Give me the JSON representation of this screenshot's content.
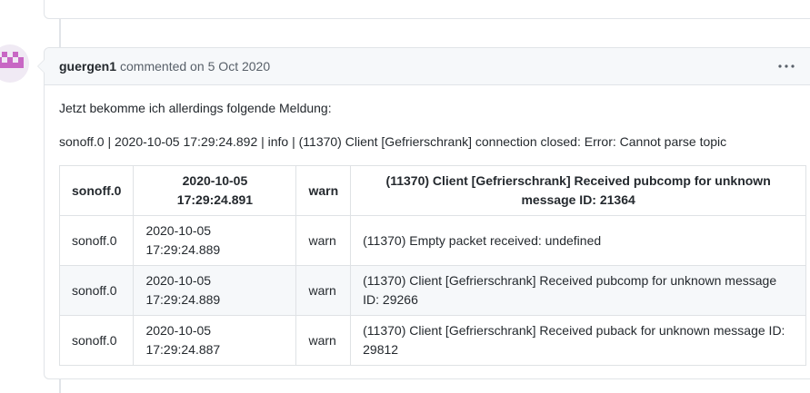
{
  "comment": {
    "author": "guergen1",
    "action_text": "commented on",
    "date": "5 Oct 2020",
    "paragraph1": "Jetzt bekomme ich allerdings folgende Meldung:",
    "paragraph2": "sonoff.0 | 2020-10-05 17:29:24.892 | info | (11370) Client [Gefrierschrank] connection closed: Error: Cannot parse topic"
  },
  "table": {
    "header": [
      "sonoff.0",
      "2020-10-05 17:29:24.891",
      "warn",
      "(11370) Client [Gefrierschrank] Received pubcomp for unknown message ID: 21364"
    ],
    "rows": [
      [
        "sonoff.0",
        "2020-10-05 17:29:24.889",
        "warn",
        "(11370) Empty packet received: undefined"
      ],
      [
        "sonoff.0",
        "2020-10-05 17:29:24.889",
        "warn",
        "(11370) Client [Gefrierschrank] Received pubcomp for unknown message ID: 29266"
      ],
      [
        "sonoff.0",
        "2020-10-05 17:29:24.887",
        "warn",
        "(11370) Client [Gefrierschrank] Received puback for unknown message ID: 29812"
      ]
    ]
  },
  "icons": {
    "avatar": "identicon-avatar",
    "more": "kebab-horizontal-icon"
  },
  "colors": {
    "avatar_fill": "#c867c4",
    "header_bg": "#f6f8fa",
    "border": "#e1e4e8"
  }
}
